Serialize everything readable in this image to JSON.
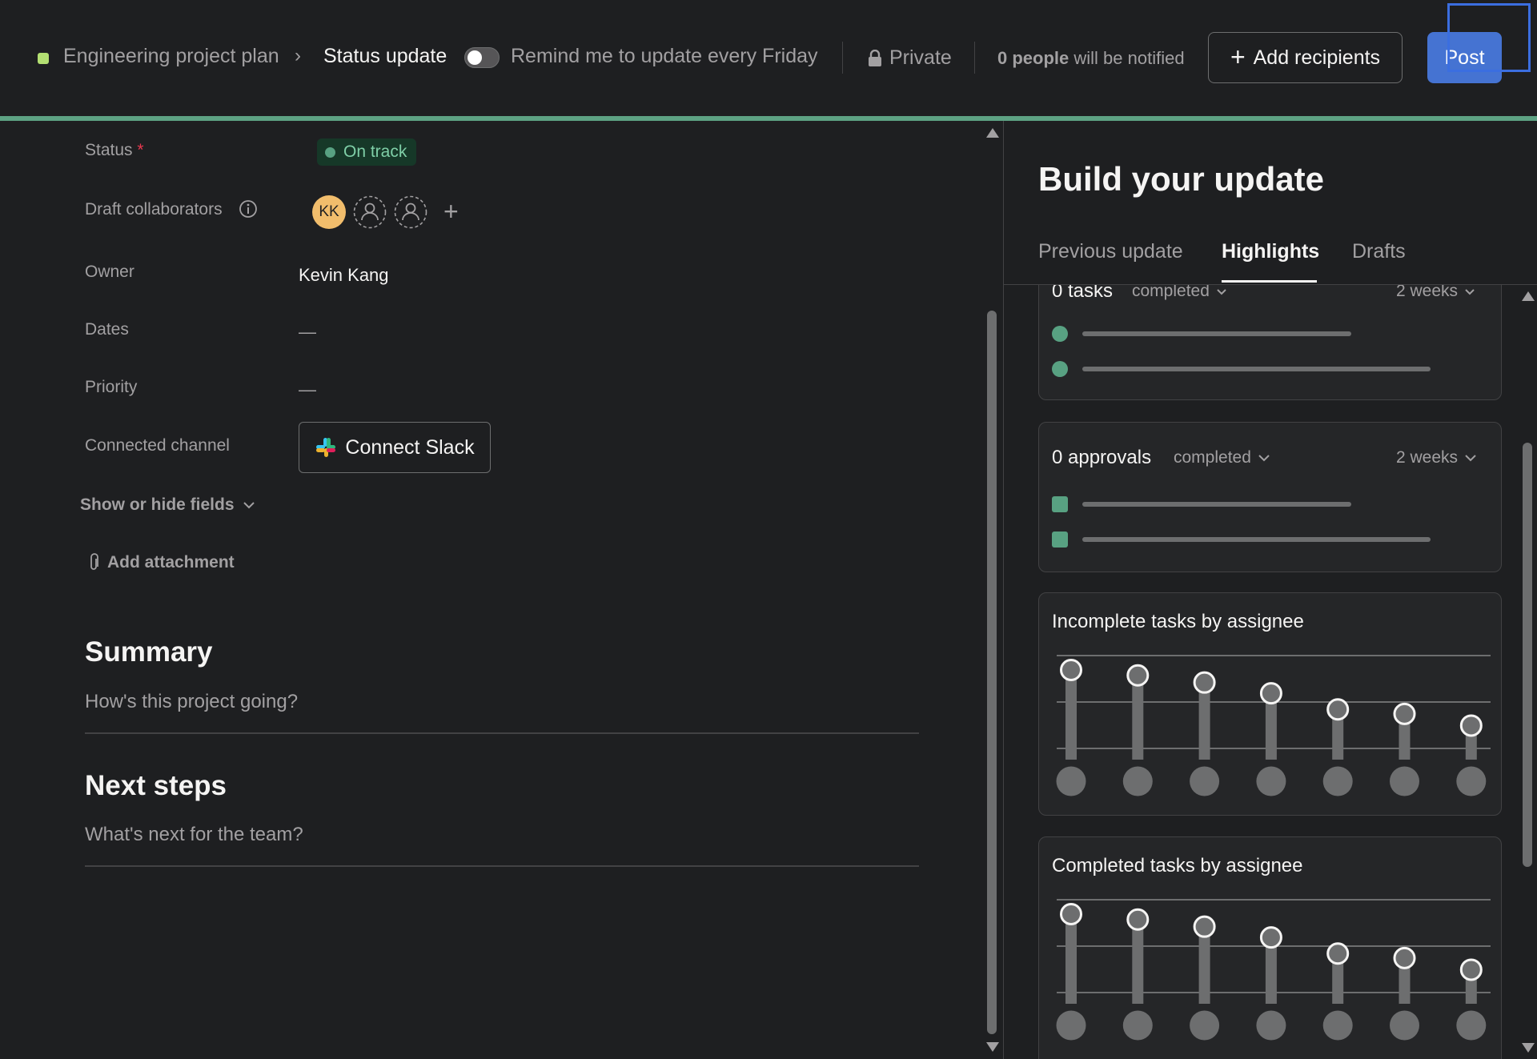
{
  "topbar": {
    "project_name": "Engineering project plan",
    "breadcrumb_separator": "›",
    "current_page": "Status update",
    "remind_toggle_on": false,
    "remind_label": "Remind me to update every Friday",
    "privacy_label": "Private",
    "notify_count": "0 people",
    "notify_suffix": " will be notified",
    "add_recipients_label": "Add recipients",
    "post_label": "Post",
    "project_color": "#b3df72",
    "accent_line_color": "#5da283",
    "post_button_color": "#4573d2"
  },
  "form": {
    "status_label": "Status",
    "status_required_marker": "*",
    "status_value": "On track",
    "collaborators_label": "Draft collaborators",
    "collaborator_initials": "KK",
    "owner_label": "Owner",
    "owner_value": "Kevin Kang",
    "dates_label": "Dates",
    "dates_value": "—",
    "priority_label": "Priority",
    "priority_value": "—",
    "channel_label": "Connected channel",
    "connect_slack_label": "Connect Slack",
    "show_hide_label": "Show or hide fields",
    "add_attachment_label": "Add attachment"
  },
  "summary": {
    "title": "Summary",
    "placeholder": "How's this project going?"
  },
  "next_steps": {
    "title": "Next steps",
    "placeholder": "What's next for the team?"
  },
  "panel": {
    "title": "Build your update",
    "tabs": [
      {
        "label": "Previous update",
        "active": false
      },
      {
        "label": "Highlights",
        "active": true
      },
      {
        "label": "Drafts",
        "active": false
      }
    ],
    "tasks_card": {
      "count_label": "0 tasks",
      "filter_label": "completed",
      "range_label": "2 weeks",
      "rows": 2
    },
    "approvals_card": {
      "count_label": "0 approvals",
      "filter_label": "completed",
      "range_label": "2 weeks",
      "rows": 2
    },
    "incomplete_chart": {
      "title": "Incomplete tasks by assignee",
      "lollipop_levels": [
        1.0,
        0.94,
        0.86,
        0.74,
        0.56,
        0.51,
        0.38
      ]
    },
    "completed_chart": {
      "title": "Completed tasks by assignee",
      "lollipop_levels": [
        1.0,
        0.94,
        0.86,
        0.74,
        0.56,
        0.51,
        0.38
      ]
    }
  },
  "colors": {
    "background": "#1e1f21",
    "card": "#252628",
    "text_primary": "#f5f4f3",
    "text_secondary": "#a2a0a2",
    "status_green": "#58a182",
    "avatar_yellow": "#f1bd6c"
  }
}
